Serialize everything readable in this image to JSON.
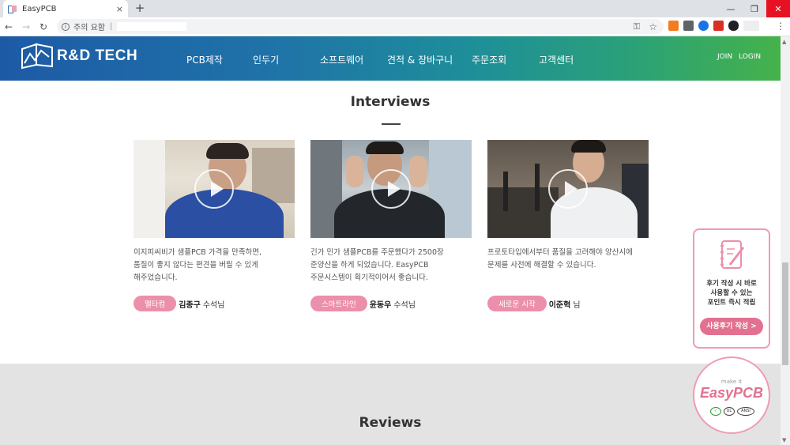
{
  "browser": {
    "tab_title": "EasyPCB",
    "tab_close": "×",
    "new_tab": "+",
    "security_label": "주의 요함",
    "window_buttons": [
      "—",
      "❐",
      "✕"
    ]
  },
  "nav": {
    "logo_text": "R&D TECH",
    "menu": [
      "PCB제작",
      "인두기",
      "소프트웨어",
      "견적 & 장바구니",
      "주문조회",
      "고객센터"
    ],
    "join": "JOIN",
    "login": "LOGIN"
  },
  "interviews": {
    "title": "Interviews",
    "cards": [
      {
        "desc": [
          "이지피씨비가 샘플PCB 가격을 만족하면,",
          "품질이 좋지 않다는 편견을 버릴 수 있게",
          "해주었습니다."
        ],
        "tag": "멜타컴",
        "name": "김종구",
        "title": "수석님"
      },
      {
        "desc": [
          "긴가 민가 샘플PCB를 주문했다가 2500장",
          "준양산을 하게 되었습니다. EasyPCB",
          "주문시스템이 획기적이어서 좋습니다."
        ],
        "tag": "스마트라인",
        "name": "윤동우",
        "title": "수석님"
      },
      {
        "desc": [
          "프로토타입에서부터 품질을 고려해야 양산시에",
          "문제를 사전에 해결할 수 있습니다."
        ],
        "tag": "새로운 시작",
        "name": "이준혁",
        "title": "님"
      }
    ]
  },
  "reviews": {
    "title": "Reviews"
  },
  "float_review": {
    "lines": [
      "후기 작성 시 바로",
      "사용할 수 있는",
      "포인트 즉시 적립"
    ],
    "button": "사용후기 작성 >"
  },
  "float_brand": {
    "small": "make it",
    "logo": "EasyPCB",
    "certs": [
      "UL",
      "ANSI"
    ]
  }
}
